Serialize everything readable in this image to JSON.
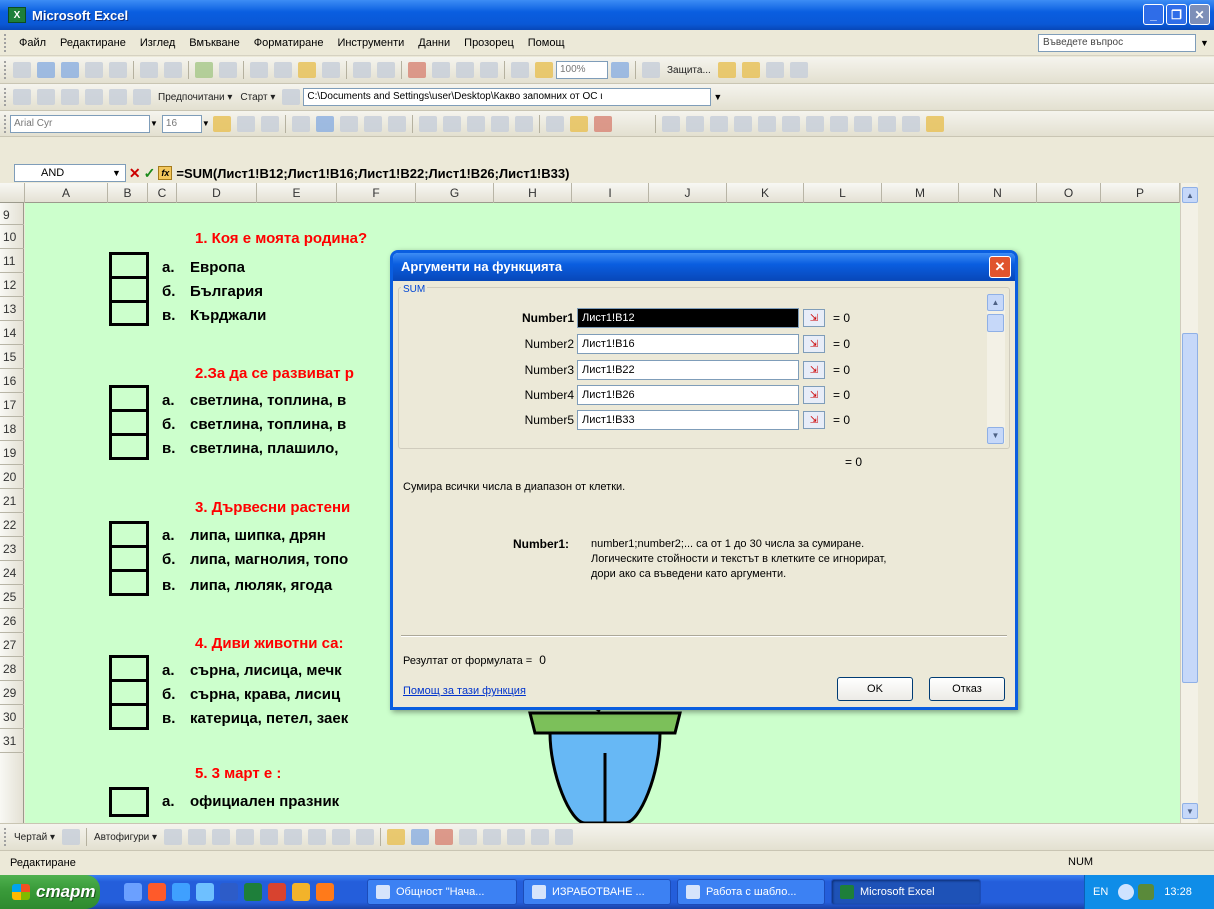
{
  "app": {
    "title": "Microsoft Excel",
    "icon": "excel-icon"
  },
  "menu": {
    "items": [
      "Файл",
      "Редактиране",
      "Изглед",
      "Вмъкване",
      "Форматиране",
      "Инструменти",
      "Данни",
      "Прозорец",
      "Помощ"
    ],
    "ask_placeholder": "Въведете въпрос"
  },
  "toolbar": {
    "zoom": "100%",
    "protect_label": "Защита...",
    "favorites_label": "Предпочитани ▾",
    "start_label": "Старт ▾",
    "path": "C:\\Documents and Settings\\user\\Desktop\\Какво запомних от ОС ι",
    "font_name": "Arial Cyr",
    "font_size": "16"
  },
  "formula_bar": {
    "name_box": "AND",
    "formula": "=SUM(Лист1!B12;Лист1!B16;Лист1!B22;Лист1!B26;Лист1!B33)"
  },
  "grid": {
    "columns": [
      "A",
      "B",
      "C",
      "D",
      "E",
      "F",
      "G",
      "H",
      "I",
      "J",
      "K",
      "L",
      "M",
      "N",
      "O",
      "P"
    ],
    "rows": [
      "9",
      "10",
      "11",
      "12",
      "13",
      "14",
      "15",
      "16",
      "17",
      "18",
      "19",
      "20",
      "21",
      "22",
      "23",
      "24",
      "25",
      "26",
      "27",
      "28",
      "29",
      "30",
      "31"
    ],
    "questions": [
      {
        "title": "1. Коя е моята родина?",
        "answers": [
          {
            "letter": "а.",
            "text": "Европа"
          },
          {
            "letter": "б.",
            "text": "България"
          },
          {
            "letter": "в.",
            "text": "Кърджали"
          }
        ]
      },
      {
        "title": "2.За да се развиват р",
        "answers": [
          {
            "letter": "а.",
            "text": "светлина, топлина, в"
          },
          {
            "letter": "б.",
            "text": "светлина, топлина, в"
          },
          {
            "letter": "в.",
            "text": "светлина, плашило,"
          }
        ]
      },
      {
        "title": "3. Дървесни растени",
        "answers": [
          {
            "letter": "а.",
            "text": "липа, шипка, дрян"
          },
          {
            "letter": "б.",
            "text": "липа, магнолия, топо"
          },
          {
            "letter": "в.",
            "text": "липа, люляк, ягода"
          }
        ]
      },
      {
        "title": "4. Диви животни са:",
        "answers": [
          {
            "letter": "а.",
            "text": "сърна, лисица, мечк"
          },
          {
            "letter": "б.",
            "text": "сърна, крава, лисиц"
          },
          {
            "letter": "в.",
            "text": "катерица, петел, заек"
          }
        ]
      },
      {
        "title": "5. 3 март е :",
        "answers": [
          {
            "letter": "а.",
            "text": "официален празник"
          }
        ]
      }
    ]
  },
  "dialog": {
    "title": "Аргументи на функцията",
    "function_name": "SUM",
    "args": [
      {
        "label": "Number1",
        "value": "Лист1!B12",
        "result": "= 0"
      },
      {
        "label": "Number2",
        "value": "Лист1!B16",
        "result": "= 0"
      },
      {
        "label": "Number3",
        "value": "Лист1!B22",
        "result": "= 0"
      },
      {
        "label": "Number4",
        "value": "Лист1!B26",
        "result": "= 0"
      },
      {
        "label": "Number5",
        "value": "Лист1!B33",
        "result": "= 0"
      }
    ],
    "total": "= 0",
    "description": "Сумира всички числа в диапазон от клетки.",
    "number_label": "Number1:",
    "number_desc_line1": "number1;number2;... са от 1 до 30 числа за сумиране.",
    "number_desc_line2": "Логическите стойности и текстът в клетките се игнорират,",
    "number_desc_line3": "дори ако са въведени като аргументи.",
    "result_label": "Резултат от формулата =",
    "result_value": "0",
    "help_link": "Помощ за тази функция",
    "ok": "OK",
    "cancel": "Отказ"
  },
  "drawbar": {
    "draw_label": "Чертай ▾",
    "autoshapes_label": "Автофигури ▾"
  },
  "status": {
    "mode": "Редактиране",
    "num": "NUM"
  },
  "taskbar": {
    "start": "старт",
    "buttons": [
      "Общност \"Нача...",
      "ИЗРАБОТВАНЕ ...",
      "Работа с шабло...",
      "Microsoft Excel"
    ],
    "lang": "EN",
    "clock": "13:28"
  }
}
